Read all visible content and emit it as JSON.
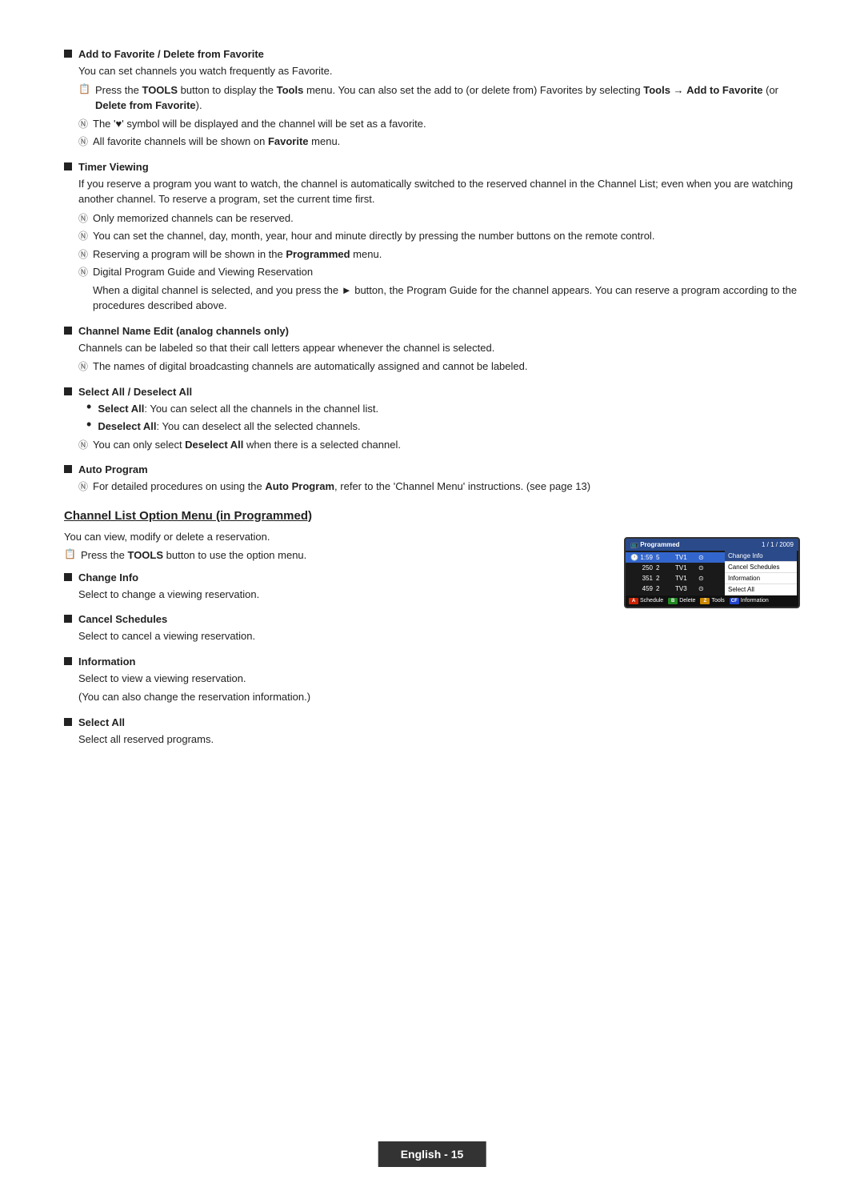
{
  "sections": [
    {
      "id": "add-favorite",
      "title": "Add to Favorite / Delete from Favorite",
      "body": "You can set channels you watch frequently as Favorite.",
      "notes": [
        {
          "type": "tools",
          "text": "Press the TOOLS button to display the Tools menu. You can also set the add to (or delete from) Favorites by selecting Tools → Add to Favorite (or Delete from Favorite).",
          "boldParts": [
            "TOOLS",
            "Tools",
            "Tools",
            "Add to Favorite",
            "Delete from Favorite"
          ]
        },
        {
          "type": "info",
          "text": "The '♥' symbol will be displayed and the channel will be set as a favorite."
        },
        {
          "type": "info",
          "text": "All favorite channels will be shown on Favorite menu.",
          "boldParts": [
            "Favorite"
          ]
        }
      ]
    },
    {
      "id": "timer-viewing",
      "title": "Timer Viewing",
      "body": "If you reserve a program you want to watch, the channel is automatically switched to the reserved channel in the Channel List; even when you are watching another channel. To reserve a program, set the current time first.",
      "notes": [
        {
          "type": "info",
          "text": "Only memorized channels can be reserved."
        },
        {
          "type": "info",
          "text": "You can set the channel, day, month, year, hour and minute directly by pressing the number buttons on the remote control."
        },
        {
          "type": "info",
          "text": "Reserving a program will be shown in the Programmed menu.",
          "boldParts": [
            "Programmed"
          ]
        },
        {
          "type": "subheading",
          "text": "Digital Program Guide and Viewing Reservation",
          "body": "When a digital channel is selected, and you press the ▶ button, the Program Guide for the channel appears. You can reserve a program according to the procedures described above."
        }
      ]
    },
    {
      "id": "channel-name-edit",
      "title": "Channel Name Edit (analog channels only)",
      "body": "Channels can be labeled so that their call letters appear whenever the channel is selected.",
      "notes": [
        {
          "type": "info",
          "text": "The names of digital broadcasting channels are automatically assigned and cannot be labeled."
        }
      ]
    },
    {
      "id": "select-all",
      "title": "Select All / Deselect All",
      "bullets": [
        {
          "label": "Select All",
          "text": ": You can select all the channels in the channel list."
        },
        {
          "label": "Deselect All",
          "text": ": You can deselect all the selected channels."
        }
      ],
      "notes": [
        {
          "type": "info",
          "text": "You can only select Deselect All when there is a selected channel.",
          "boldParts": [
            "Deselect All"
          ]
        }
      ]
    },
    {
      "id": "auto-program",
      "title": "Auto Program",
      "notes": [
        {
          "type": "info",
          "text": "For detailed procedures on using the Auto Program, refer to the 'Channel Menu' instructions. (see page 13)",
          "boldParts": [
            "Auto Program"
          ]
        }
      ]
    }
  ],
  "channel_list_section": {
    "title": "Channel List Option Menu (in Programmed)",
    "intro": "You can view, modify or delete a reservation.",
    "tools_note": "Press the TOOLS button to use the option menu.",
    "subsections": [
      {
        "title": "Change Info",
        "body": "Select to change a viewing reservation."
      },
      {
        "title": "Cancel Schedules",
        "body": "Select to cancel a viewing reservation."
      },
      {
        "title": "Information",
        "body1": "Select to view a viewing reservation.",
        "body2": "(You can also change the reservation information.)"
      },
      {
        "title": "Select All",
        "body": "Select all reserved programs."
      }
    ],
    "tv_screenshot": {
      "header_left": "Programmed",
      "header_date": "1 / 1 / 2009",
      "rows": [
        {
          "num": "1:59",
          "ch": "5",
          "name": "TV1",
          "icon": "⊙",
          "highlight": true
        },
        {
          "num": "250",
          "ch": "2",
          "name": "TV1",
          "icon": "⊙",
          "highlight": false
        },
        {
          "num": "351",
          "ch": "2",
          "name": "TV1",
          "icon": "⊙",
          "highlight": false
        },
        {
          "num": "459",
          "ch": "2",
          "name": "TV3",
          "icon": "⊙",
          "highlight": false
        }
      ],
      "menu_items": [
        {
          "label": "Change Info",
          "active": true
        },
        {
          "label": "Cancel Schedules",
          "active": false
        },
        {
          "label": "Information",
          "active": false
        },
        {
          "label": "Select All",
          "active": false
        }
      ],
      "footer": [
        {
          "color": "red",
          "label": "A",
          "text": "Schedule"
        },
        {
          "color": "green",
          "label": "B",
          "text": "Delete"
        },
        {
          "color": "yellow",
          "label": "Z",
          "text": "Tools"
        },
        {
          "color": "blue",
          "label": "CF",
          "text": "Information"
        }
      ]
    }
  },
  "page_footer": {
    "text": "English - 15"
  }
}
